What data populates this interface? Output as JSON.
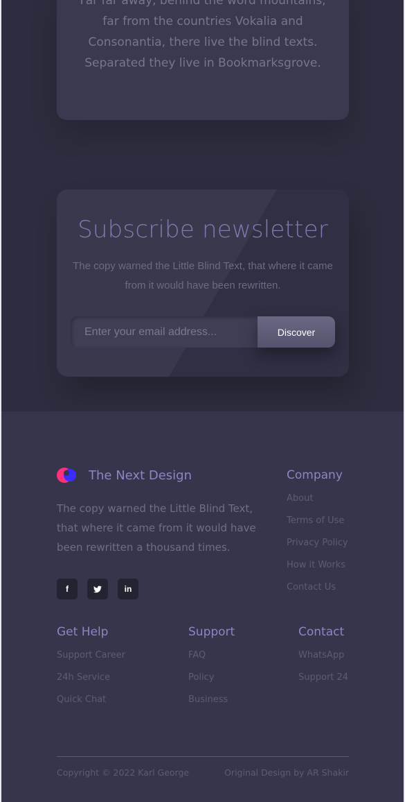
{
  "intro": {
    "text": "Far far away, behind the word mountains, far from the countries Vokalia and Consonantia, there live the blind texts. Separated they live in Bookmarksgrove."
  },
  "newsletter": {
    "title": "Subscribe newsletter",
    "description": "The copy warned the Little Blind Text, that where it came from it would have been rewritten.",
    "email_placeholder": "Enter your email address...",
    "button_label": "Discover"
  },
  "footer": {
    "brand_name": "The Next Design",
    "description": "The copy warned the Little Blind Text, that where it came from it would have been rewritten a thousand times.",
    "socials": [
      {
        "icon": "facebook-icon",
        "glyph": "f"
      },
      {
        "icon": "twitter-icon",
        "glyph": "t"
      },
      {
        "icon": "linkedin-icon",
        "glyph": "in"
      }
    ],
    "company": {
      "title": "Company",
      "links": [
        "About",
        "Terms of Use",
        "Privacy Policy",
        "How it Works",
        "Contact Us"
      ]
    },
    "get_help": {
      "title": "Get Help",
      "links": [
        "Support Career",
        "24h Service",
        "Quick Chat"
      ]
    },
    "support": {
      "title": "Support",
      "links": [
        "FAQ",
        "Policy",
        "Business"
      ]
    },
    "contact": {
      "title": "Contact",
      "links": [
        "WhatsApp",
        "Support 24"
      ]
    },
    "copyright": "Copyright © 2022 Karl George",
    "credit": "Original Design by AR Shakir"
  },
  "colors": {
    "accent": "#8b86c4",
    "logo_pink": "#ff2f7a",
    "logo_blue": "#3b2cff"
  }
}
